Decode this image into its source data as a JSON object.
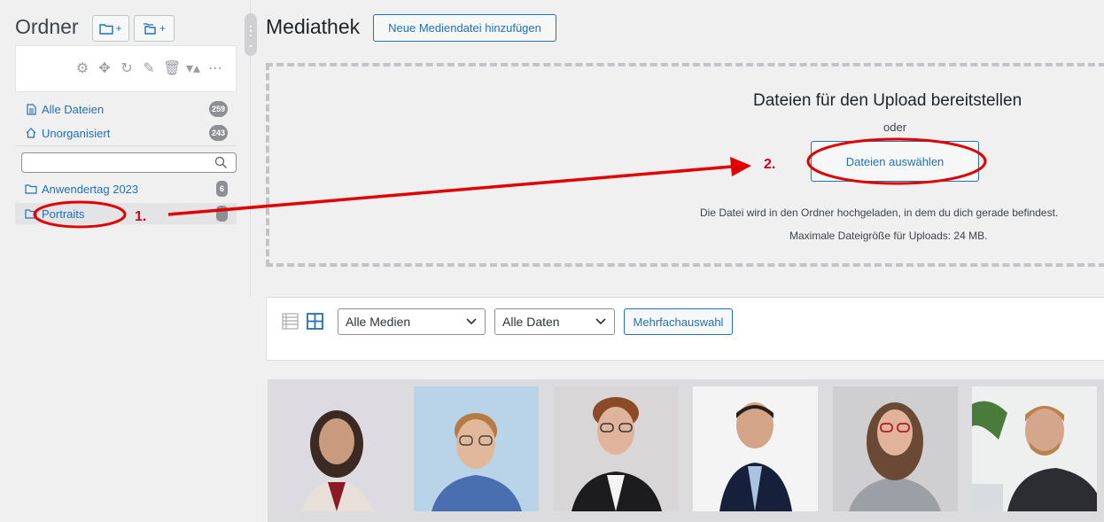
{
  "sidebar": {
    "title": "Ordner",
    "add_folder_label": "+",
    "add_subfolder_label": "+",
    "nav": [
      {
        "label": "Alle Dateien",
        "count": "259",
        "icon": "file-icon"
      },
      {
        "label": "Unorganisiert",
        "count": "243",
        "icon": "home-icon"
      }
    ],
    "search_placeholder": "",
    "folders": [
      {
        "label": "Anwendertag 2023",
        "count": "6",
        "icon": "folder-icon"
      },
      {
        "label": "Portraits",
        "count": "",
        "icon": "folder-icon"
      }
    ]
  },
  "main": {
    "title": "Mediathek",
    "add_button": "Neue Mediendatei hinzufügen"
  },
  "upload": {
    "title": "Dateien für den Upload bereitstellen",
    "or": "oder",
    "select_button": "Dateien auswählen",
    "info1": "Die Datei wird in den Ordner hochgeladen, in dem du dich gerade befindest.",
    "info2": "Maximale Dateigröße für Uploads: 24 MB."
  },
  "filters": {
    "media_type": "Alle Medien",
    "dates": "Alle Daten",
    "bulk_select": "Mehrfachauswahl"
  },
  "annotations": {
    "step1": "1.",
    "step2": "2."
  },
  "colors": {
    "accent": "#2271b1",
    "annotation": "#e00000",
    "badge": "#8c8f94"
  }
}
